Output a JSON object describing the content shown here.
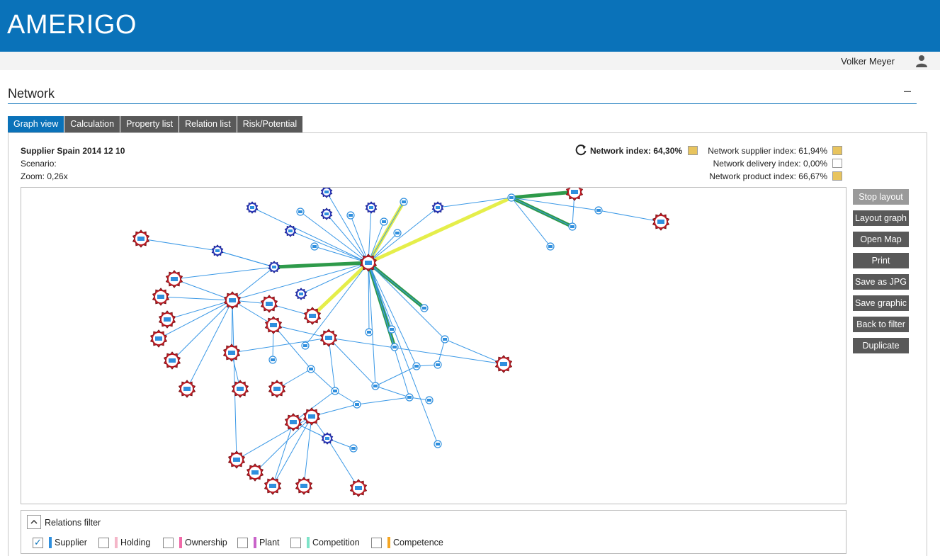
{
  "app": {
    "title": "AMERIGO"
  },
  "user": {
    "name": "Volker Meyer",
    "icon": "user-icon"
  },
  "section": {
    "title": "Network",
    "collapse_label": "–"
  },
  "tabs": [
    {
      "label": "Graph view",
      "active": true
    },
    {
      "label": "Calculation",
      "active": false
    },
    {
      "label": "Property list",
      "active": false
    },
    {
      "label": "Relation list",
      "active": false
    },
    {
      "label": "Risk/Potential",
      "active": false
    }
  ],
  "info": {
    "name": "Supplier Spain 2014 12 10",
    "scenario": "Scenario:",
    "zoom": "Zoom: 0,26x"
  },
  "indices": {
    "network": {
      "label": "Network index: 64,30%",
      "color": "#e8c45e"
    },
    "supplier": {
      "label": "Network supplier index: 61,94%",
      "color": "#e8c45e"
    },
    "delivery": {
      "label": "Network delivery index:   0,00%",
      "color": "#ffffff"
    },
    "product": {
      "label": "Network product index: 66,67%",
      "color": "#e8c45e"
    }
  },
  "buttons": [
    {
      "label": "Stop layout",
      "enabled": false
    },
    {
      "label": "Layout graph",
      "enabled": true
    },
    {
      "label": "Open Map",
      "enabled": true
    },
    {
      "label": "Print",
      "enabled": true
    },
    {
      "label": "Save as JPG",
      "enabled": true
    },
    {
      "label": "Save graphic",
      "enabled": true
    },
    {
      "label": "Back to filter",
      "enabled": true
    },
    {
      "label": "Duplicate",
      "enabled": true
    }
  ],
  "filter": {
    "title": "Relations filter",
    "items": [
      {
        "label": "Supplier",
        "checked": true,
        "color": "#2f8fde"
      },
      {
        "label": "Holding",
        "checked": false,
        "color": "#f4b6c8"
      },
      {
        "label": "Ownership",
        "checked": false,
        "color": "#f06aa8"
      },
      {
        "label": "Plant",
        "checked": false,
        "color": "#c963c9"
      },
      {
        "label": "Competition",
        "checked": false,
        "color": "#7de3c8"
      },
      {
        "label": "Competence",
        "checked": false,
        "color": "#f5a623"
      }
    ]
  },
  "graph": {
    "colors": {
      "edge": "#3a98e6",
      "risk": "#c8202a",
      "company": "#2f3ec9",
      "highlight_green": "#2e9a4a",
      "highlight_yellow": "#e5ee4a"
    }
  }
}
